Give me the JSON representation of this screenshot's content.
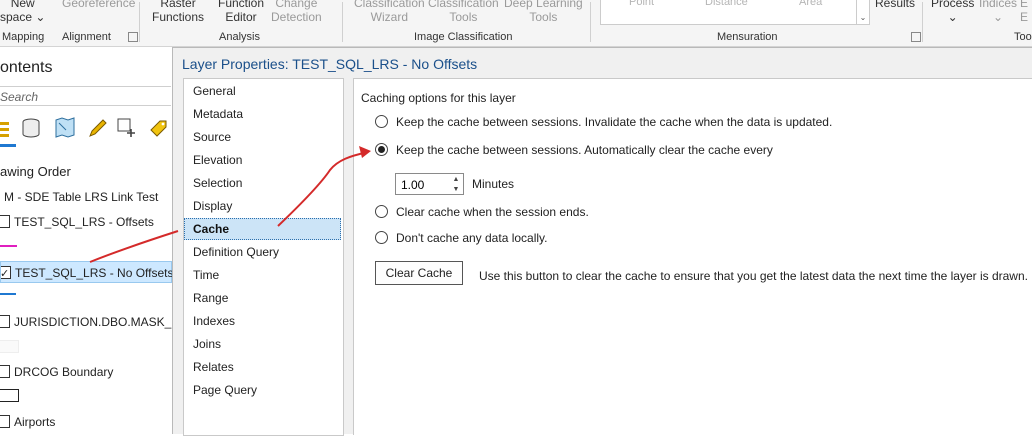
{
  "ribbon": {
    "tools": [
      {
        "label": "New\nspace",
        "dim": false
      },
      {
        "label": "Georeference",
        "dim": true
      },
      {
        "label": "Raster\nFunctions",
        "dim": false
      },
      {
        "label": "Function\nEditor",
        "dim": false
      },
      {
        "label": "Change\nDetection",
        "dim": true
      },
      {
        "label": "Classification\nWizard",
        "dim": true
      },
      {
        "label": "Classification\nTools",
        "dim": true
      },
      {
        "label": "Deep Learning\nTools",
        "dim": true
      },
      {
        "label": "Results",
        "dim": false
      },
      {
        "label": "Process",
        "dim": false
      },
      {
        "label": "Indices",
        "dim": true
      }
    ],
    "mensuration_tools": [
      "Point",
      "Distance",
      "Area"
    ],
    "groups": [
      "Mapping",
      "Alignment",
      "Analysis",
      "Image Classification",
      "Mensuration",
      "Too"
    ]
  },
  "contents": {
    "title": "ontents",
    "search_placeholder": "Search",
    "drawing_order": "awing Order",
    "layers": [
      {
        "label": "M - SDE Table LRS Link Test",
        "checkbox": false,
        "checked": false
      },
      {
        "label": "TEST_SQL_LRS - Offsets",
        "checkbox": true,
        "checked": false
      },
      {
        "label": "TEST_SQL_LRS - No Offsets",
        "checkbox": true,
        "checked": true
      },
      {
        "label": "JURISDICTION.DBO.MASK_DRC",
        "checkbox": true,
        "checked": false
      },
      {
        "label": "DRCOG Boundary",
        "checkbox": true,
        "checked": false
      },
      {
        "label": "Airports",
        "checkbox": true,
        "checked": false
      }
    ],
    "colors": {
      "offsets_line": "#e01fbf",
      "no_offsets_line": "#1f78d1"
    }
  },
  "dialog": {
    "title": "Layer Properties: TEST_SQL_LRS - No Offsets",
    "nav": [
      "General",
      "Metadata",
      "Source",
      "Elevation",
      "Selection",
      "Display",
      "Cache",
      "Definition Query",
      "Time",
      "Range",
      "Indexes",
      "Joins",
      "Relates",
      "Page Query"
    ],
    "active_nav": "Cache",
    "cache": {
      "heading": "Caching options for this layer",
      "options": [
        "Keep the cache between sessions. Invalidate the cache when the data is updated.",
        "Keep the cache between sessions. Automatically clear the cache every",
        "Clear cache when the session ends.",
        "Don't cache any data locally."
      ],
      "selected_option": 1,
      "minutes_value": "1.00",
      "minutes_label": "Minutes",
      "clear_button": "Clear Cache",
      "clear_description": "Use this button to clear the cache to ensure that you get the latest data the next time the layer is drawn."
    }
  },
  "annotation_color": "#d42a2a"
}
